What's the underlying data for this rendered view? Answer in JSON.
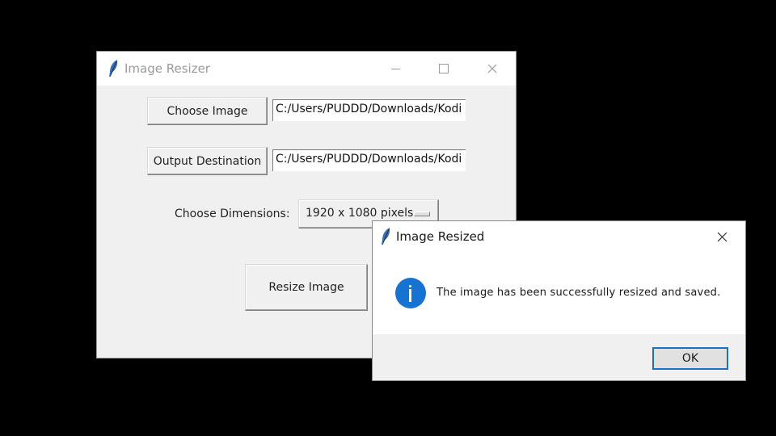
{
  "main_window": {
    "title": "Image Resizer",
    "controls": {
      "minimize": "—",
      "maximize": "☐",
      "close": "✕"
    },
    "choose_image_button": "Choose Image",
    "input_path": "C:/Users/PUDDD/Downloads/Kodi",
    "output_destination_button": "Output Destination",
    "output_path": "C:/Users/PUDDD/Downloads/Kodi",
    "dimensions_label": "Choose Dimensions:",
    "dimensions_selected": "1920 x 1080 pixels",
    "resize_button": "Resize Image"
  },
  "dialog": {
    "title": "Image Resized",
    "close": "✕",
    "icon": "info-icon",
    "message": "The image has been successfully resized and saved.",
    "ok_button": "OK",
    "accent_color": "#1773d1"
  }
}
